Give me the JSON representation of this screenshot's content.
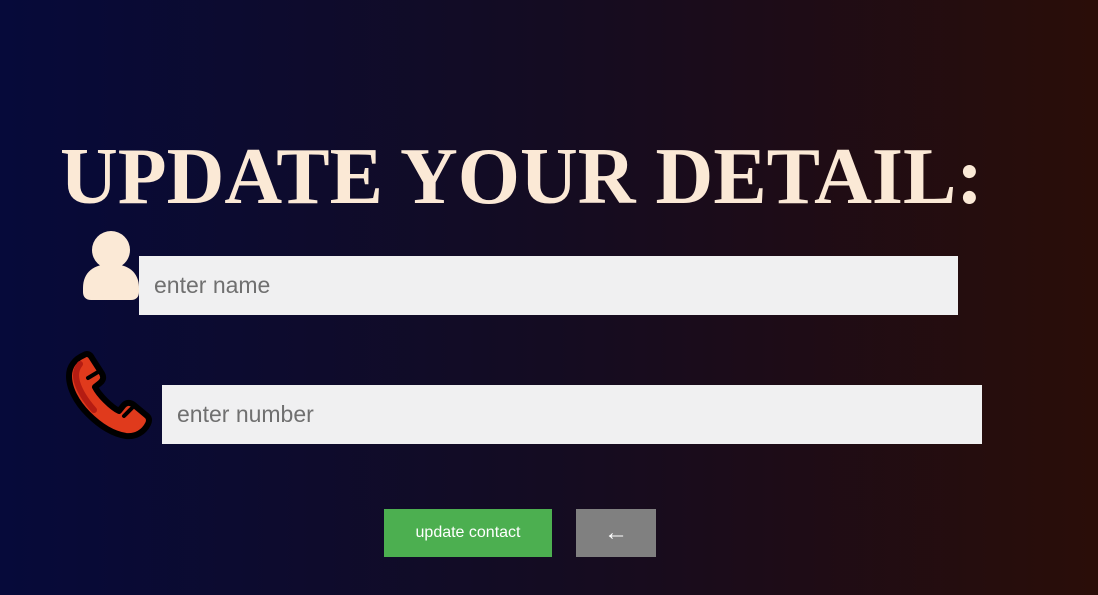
{
  "page": {
    "heading": "UPDATE YOUR DETAIL:"
  },
  "form": {
    "name_field": {
      "icon": "person-icon",
      "value": "",
      "placeholder": "enter name"
    },
    "number_field": {
      "icon": "phone-icon",
      "value": "",
      "placeholder": "enter number"
    }
  },
  "actions": {
    "update_label": "update contact",
    "back_label": "←"
  },
  "colors": {
    "heading": "#fbe9d6",
    "update_button": "#4caf50",
    "back_button": "#808080",
    "phone_icon": "#e03a1c",
    "person_icon": "#fbe9d6"
  }
}
